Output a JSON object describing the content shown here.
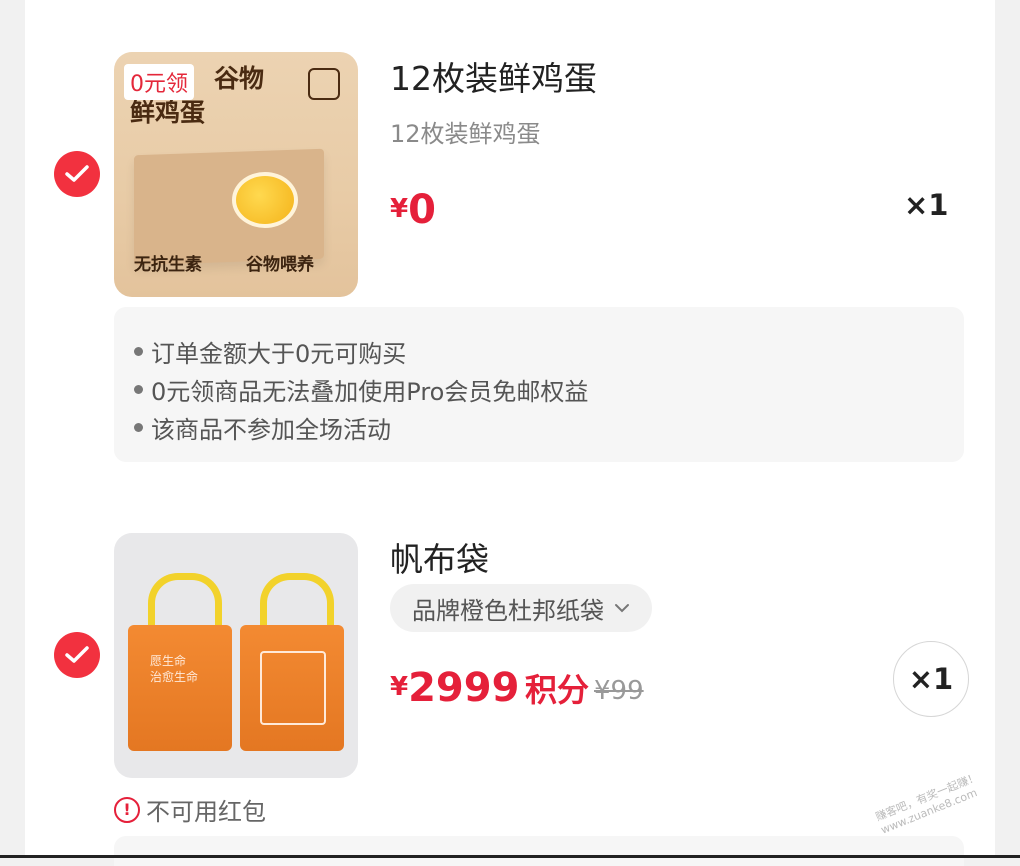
{
  "items": [
    {
      "image_tag": "0元领",
      "image_title_line1": "谷物",
      "image_title_line2": "鲜鸡蛋",
      "image_badge1": "无抗生素",
      "image_badge2": "谷物喂养",
      "title": "12枚装鲜鸡蛋",
      "subtitle": "12枚装鲜鸡蛋",
      "price_symbol": "¥",
      "price": "0",
      "quantity": "×1",
      "selected": true,
      "notes": [
        "订单金额大于0元可购买",
        "0元领商品无法叠加使用Pro会员免邮权益",
        "该商品不参加全场活动"
      ]
    },
    {
      "image_text_line1": "愿生命",
      "image_text_line2": "治愈生命",
      "title": "帆布袋",
      "spec": "品牌橙色杜邦纸袋",
      "price_symbol": "¥",
      "price": "2999",
      "price_unit": "积分",
      "original_price": "¥99",
      "quantity": "×1",
      "selected": true,
      "warning": "不可用红包"
    }
  ],
  "watermark": {
    "line1": "赚客吧，有奖一起赚！",
    "line2": "www.zuanke8.com"
  },
  "colors": {
    "accent": "#f2313f",
    "price": "#e5203a",
    "bag_handle": "#f2d22b",
    "bag_body": "#e47722"
  }
}
